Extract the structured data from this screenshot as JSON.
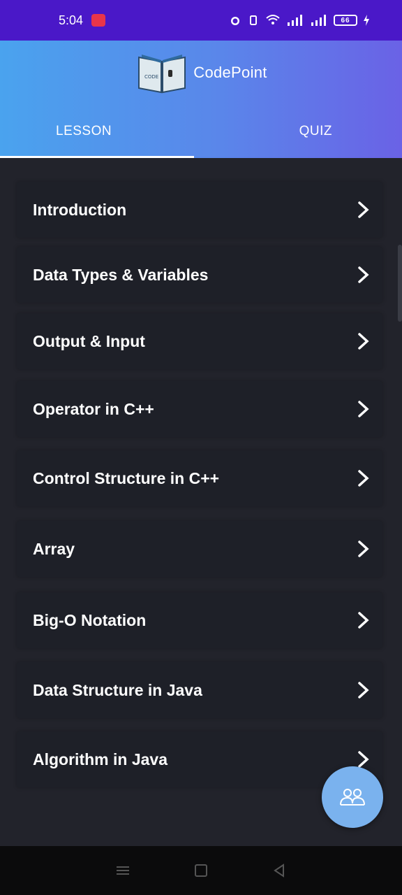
{
  "status_bar": {
    "time": "5:04",
    "battery": "66"
  },
  "header": {
    "app_name": "CodePoint",
    "logo_text": "CODE"
  },
  "tabs": [
    {
      "label": "LESSON",
      "active": true
    },
    {
      "label": "QUIZ",
      "active": false
    }
  ],
  "lessons": [
    {
      "label": "Introduction"
    },
    {
      "label": "Data Types & Variables"
    },
    {
      "label": "Output & Input"
    },
    {
      "label": "Operator in C++"
    },
    {
      "label": "Control Structure in C++"
    },
    {
      "label": "Array"
    },
    {
      "label": "Big-O Notation"
    },
    {
      "label": "Data Structure in Java"
    },
    {
      "label": "Algorithm in Java"
    }
  ],
  "fab": {
    "icon": "group-icon"
  },
  "nav": {
    "icons": [
      "menu-icon",
      "home-square-icon",
      "back-triangle-icon"
    ]
  },
  "colors": {
    "status_bar": "#4a18c8",
    "header_start": "#4aa3ee",
    "header_end": "#6a62e6",
    "background": "#22232b",
    "fab": "#7ab2ee"
  }
}
